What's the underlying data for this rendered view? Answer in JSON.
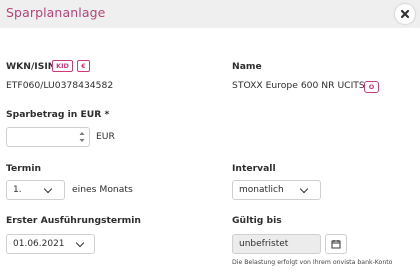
{
  "dialog": {
    "title": "Sparplananlage",
    "close_icon": "close-icon"
  },
  "wkn": {
    "label": "WKN/ISIN",
    "kid_badge": "KID",
    "euro_badge": "€",
    "value": "ETF060/LU0378434582"
  },
  "name": {
    "label": "Name",
    "value": "STOXX Europe 600 NR UCITS",
    "info_badge": "O"
  },
  "amount": {
    "label": "Sparbetrag in EUR *",
    "value": "",
    "currency": "EUR"
  },
  "termin": {
    "label": "Termin",
    "selected": "1.",
    "suffix": "eines Monats"
  },
  "intervall": {
    "label": "Intervall",
    "selected": "monatlich"
  },
  "first_execution": {
    "label": "Erster Ausführungstermin",
    "selected": "01.06.2021"
  },
  "valid_until": {
    "label": "Gültig bis",
    "value": "unbefristet",
    "calendar_icon": "calendar-icon",
    "note": "Die Belastung erfolgt von Ihrem onvista bank-Konto"
  },
  "colors": {
    "accent": "#c83a7c",
    "title": "#b3447a",
    "header_bg": "#efefef"
  }
}
